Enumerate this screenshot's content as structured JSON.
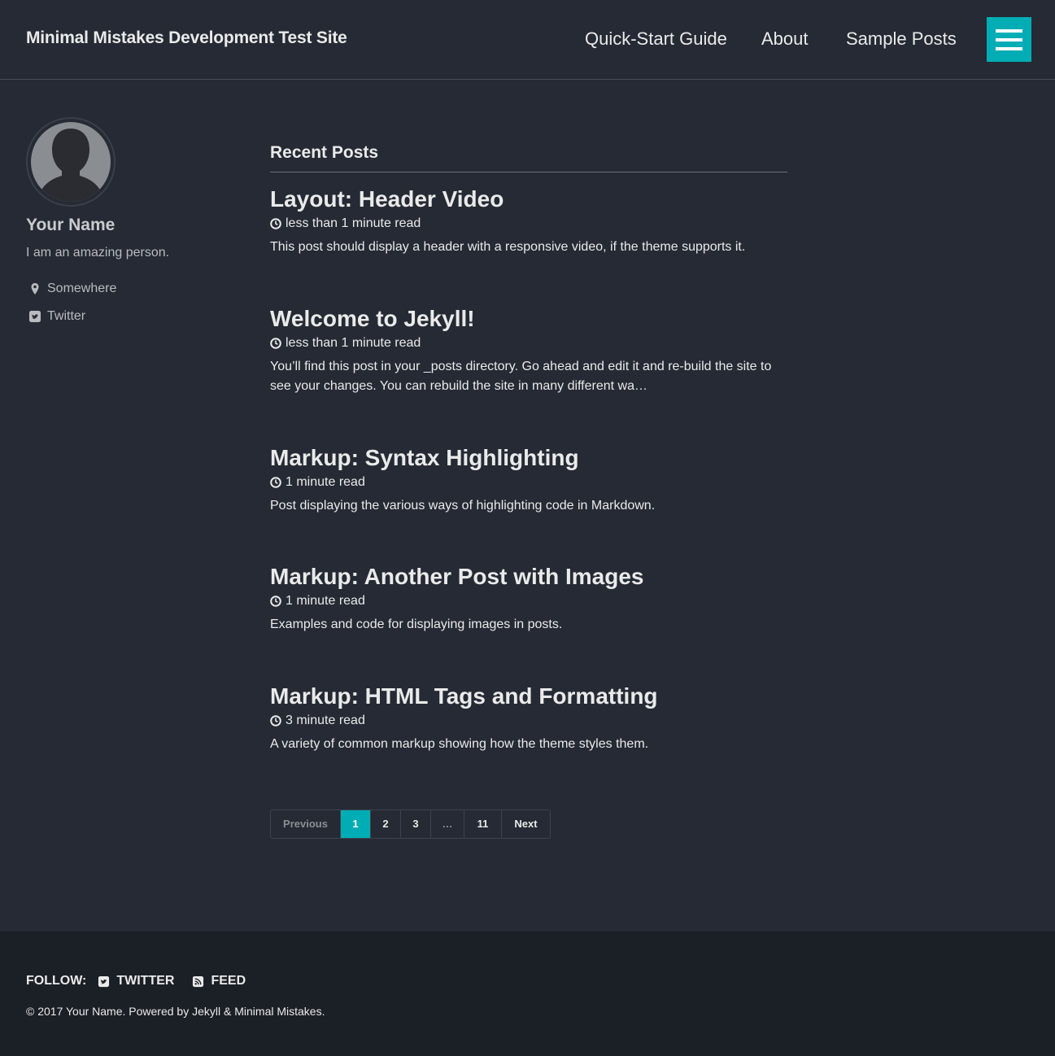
{
  "header": {
    "site_title": "Minimal Mistakes Development Test Site",
    "nav": [
      {
        "label": "Quick-Start Guide"
      },
      {
        "label": "About"
      },
      {
        "label": "Sample Posts"
      }
    ],
    "menu_icon": "hamburger-icon",
    "accent_color": "#00adb5"
  },
  "sidebar": {
    "avatar_icon": "user-silhouette",
    "name": "Your Name",
    "bio": "I am an amazing person.",
    "links": [
      {
        "label": "Somewhere",
        "icon": "map-marker-icon"
      },
      {
        "label": "Twitter",
        "icon": "twitter-square-icon"
      }
    ]
  },
  "main": {
    "section_title": "Recent Posts",
    "posts": [
      {
        "title": "Layout: Header Video",
        "read_time": "less than 1 minute read",
        "excerpt": "This post should display a header with a responsive video, if the theme supports it."
      },
      {
        "title": "Welcome to Jekyll!",
        "read_time": "less than 1 minute read",
        "excerpt": "You’ll find this post in your _posts directory. Go ahead and edit it and re-build the site to see your changes. You can rebuild the site in many different wa…"
      },
      {
        "title": "Markup: Syntax Highlighting",
        "read_time": "1 minute read",
        "excerpt": "Post displaying the various ways of highlighting code in Markdown."
      },
      {
        "title": "Markup: Another Post with Images",
        "read_time": "1 minute read",
        "excerpt": "Examples and code for displaying images in posts."
      },
      {
        "title": "Markup: HTML Tags and Formatting",
        "read_time": "3 minute read",
        "excerpt": "A variety of common markup showing how the theme styles them."
      }
    ],
    "pagination": {
      "previous": "Previous",
      "pages": [
        "1",
        "2",
        "3",
        "…",
        "11"
      ],
      "current": "1",
      "next": "Next"
    }
  },
  "footer": {
    "follow_label": "FOLLOW:",
    "links": [
      {
        "label": "TWITTER",
        "icon": "twitter-square-icon"
      },
      {
        "label": "FEED",
        "icon": "rss-square-icon"
      }
    ],
    "copyright": "© 2017 Your Name. Powered by Jekyll & Minimal Mistakes."
  }
}
